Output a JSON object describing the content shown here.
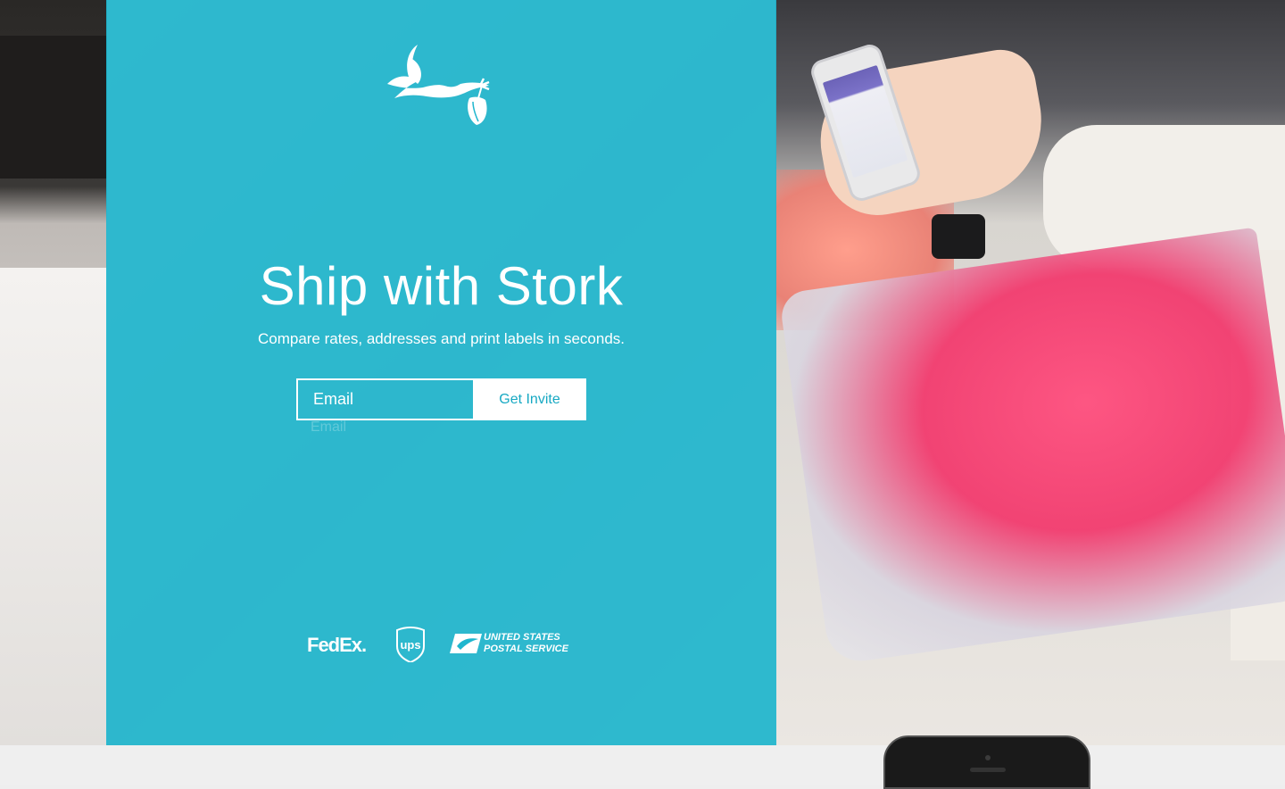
{
  "hero": {
    "headline": "Ship with Stork",
    "subhead": "Compare rates, addresses and print labels in seconds."
  },
  "signup": {
    "email_placeholder": "Email",
    "button_label": "Get Invite",
    "ghost_label": "Email"
  },
  "carriers": {
    "fedex": "FedEx.",
    "usps_line1": "UNITED STATES",
    "usps_line2": "POSTAL SERVICE"
  },
  "colors": {
    "panel": "#1fb6ce",
    "button_text": "#17a9c3"
  },
  "icons": [
    "stork-logo-icon",
    "ups-logo-icon",
    "usps-eagle-icon"
  ]
}
